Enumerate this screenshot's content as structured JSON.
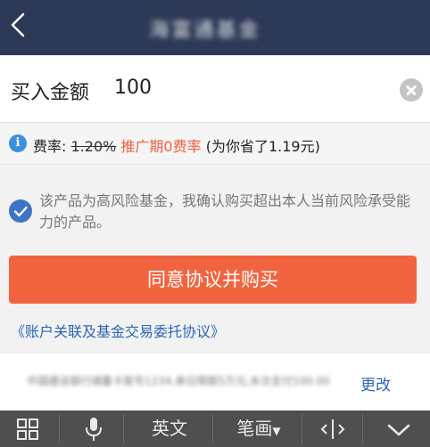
{
  "header": {
    "title": "海富通基金"
  },
  "amount": {
    "label": "买入金额",
    "value": "100"
  },
  "fee": {
    "label": "费率:",
    "old_rate": "1.20%",
    "promo": "推广期0费率",
    "saving": "(为你省了1.19元)"
  },
  "agreement": {
    "text": "该产品为高风险基金，我确认购买超出本人当前风险承受能力的产品。"
  },
  "buy_button": {
    "label": "同意协议并购买"
  },
  "link": {
    "text": "《账户关联及基金交易委托协议》"
  },
  "account": {
    "masked_text": "中国建设银行储蓄卡尾号1234,单日限额5万元,本次支付100.00元",
    "change_label": "更改"
  },
  "keyboard": {
    "english": "英文",
    "stroke": "笔画"
  },
  "colors": {
    "header_bg": "#2d3a57",
    "accent_orange": "#f26440",
    "link_blue": "#2b66b8",
    "info_blue": "#3e8fe0"
  }
}
